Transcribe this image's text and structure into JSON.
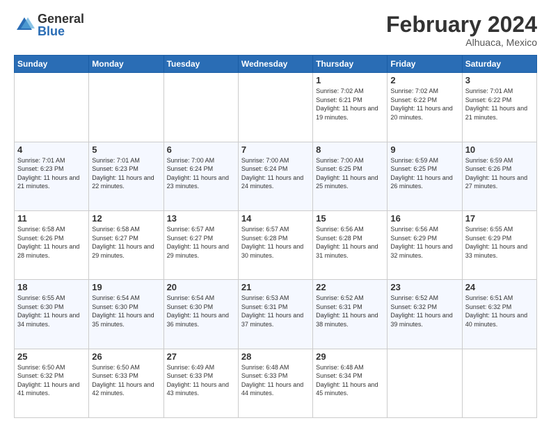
{
  "header": {
    "logo_general": "General",
    "logo_blue": "Blue",
    "title": "February 2024",
    "subtitle": "Alhuaca, Mexico"
  },
  "days_of_week": [
    "Sunday",
    "Monday",
    "Tuesday",
    "Wednesday",
    "Thursday",
    "Friday",
    "Saturday"
  ],
  "weeks": [
    [
      {
        "day": "",
        "info": ""
      },
      {
        "day": "",
        "info": ""
      },
      {
        "day": "",
        "info": ""
      },
      {
        "day": "",
        "info": ""
      },
      {
        "day": "1",
        "info": "Sunrise: 7:02 AM\nSunset: 6:21 PM\nDaylight: 11 hours and 19 minutes."
      },
      {
        "day": "2",
        "info": "Sunrise: 7:02 AM\nSunset: 6:22 PM\nDaylight: 11 hours and 20 minutes."
      },
      {
        "day": "3",
        "info": "Sunrise: 7:01 AM\nSunset: 6:22 PM\nDaylight: 11 hours and 21 minutes."
      }
    ],
    [
      {
        "day": "4",
        "info": "Sunrise: 7:01 AM\nSunset: 6:23 PM\nDaylight: 11 hours and 21 minutes."
      },
      {
        "day": "5",
        "info": "Sunrise: 7:01 AM\nSunset: 6:23 PM\nDaylight: 11 hours and 22 minutes."
      },
      {
        "day": "6",
        "info": "Sunrise: 7:00 AM\nSunset: 6:24 PM\nDaylight: 11 hours and 23 minutes."
      },
      {
        "day": "7",
        "info": "Sunrise: 7:00 AM\nSunset: 6:24 PM\nDaylight: 11 hours and 24 minutes."
      },
      {
        "day": "8",
        "info": "Sunrise: 7:00 AM\nSunset: 6:25 PM\nDaylight: 11 hours and 25 minutes."
      },
      {
        "day": "9",
        "info": "Sunrise: 6:59 AM\nSunset: 6:25 PM\nDaylight: 11 hours and 26 minutes."
      },
      {
        "day": "10",
        "info": "Sunrise: 6:59 AM\nSunset: 6:26 PM\nDaylight: 11 hours and 27 minutes."
      }
    ],
    [
      {
        "day": "11",
        "info": "Sunrise: 6:58 AM\nSunset: 6:26 PM\nDaylight: 11 hours and 28 minutes."
      },
      {
        "day": "12",
        "info": "Sunrise: 6:58 AM\nSunset: 6:27 PM\nDaylight: 11 hours and 29 minutes."
      },
      {
        "day": "13",
        "info": "Sunrise: 6:57 AM\nSunset: 6:27 PM\nDaylight: 11 hours and 29 minutes."
      },
      {
        "day": "14",
        "info": "Sunrise: 6:57 AM\nSunset: 6:28 PM\nDaylight: 11 hours and 30 minutes."
      },
      {
        "day": "15",
        "info": "Sunrise: 6:56 AM\nSunset: 6:28 PM\nDaylight: 11 hours and 31 minutes."
      },
      {
        "day": "16",
        "info": "Sunrise: 6:56 AM\nSunset: 6:29 PM\nDaylight: 11 hours and 32 minutes."
      },
      {
        "day": "17",
        "info": "Sunrise: 6:55 AM\nSunset: 6:29 PM\nDaylight: 11 hours and 33 minutes."
      }
    ],
    [
      {
        "day": "18",
        "info": "Sunrise: 6:55 AM\nSunset: 6:30 PM\nDaylight: 11 hours and 34 minutes."
      },
      {
        "day": "19",
        "info": "Sunrise: 6:54 AM\nSunset: 6:30 PM\nDaylight: 11 hours and 35 minutes."
      },
      {
        "day": "20",
        "info": "Sunrise: 6:54 AM\nSunset: 6:30 PM\nDaylight: 11 hours and 36 minutes."
      },
      {
        "day": "21",
        "info": "Sunrise: 6:53 AM\nSunset: 6:31 PM\nDaylight: 11 hours and 37 minutes."
      },
      {
        "day": "22",
        "info": "Sunrise: 6:52 AM\nSunset: 6:31 PM\nDaylight: 11 hours and 38 minutes."
      },
      {
        "day": "23",
        "info": "Sunrise: 6:52 AM\nSunset: 6:32 PM\nDaylight: 11 hours and 39 minutes."
      },
      {
        "day": "24",
        "info": "Sunrise: 6:51 AM\nSunset: 6:32 PM\nDaylight: 11 hours and 40 minutes."
      }
    ],
    [
      {
        "day": "25",
        "info": "Sunrise: 6:50 AM\nSunset: 6:32 PM\nDaylight: 11 hours and 41 minutes."
      },
      {
        "day": "26",
        "info": "Sunrise: 6:50 AM\nSunset: 6:33 PM\nDaylight: 11 hours and 42 minutes."
      },
      {
        "day": "27",
        "info": "Sunrise: 6:49 AM\nSunset: 6:33 PM\nDaylight: 11 hours and 43 minutes."
      },
      {
        "day": "28",
        "info": "Sunrise: 6:48 AM\nSunset: 6:33 PM\nDaylight: 11 hours and 44 minutes."
      },
      {
        "day": "29",
        "info": "Sunrise: 6:48 AM\nSunset: 6:34 PM\nDaylight: 11 hours and 45 minutes."
      },
      {
        "day": "",
        "info": ""
      },
      {
        "day": "",
        "info": ""
      }
    ]
  ]
}
